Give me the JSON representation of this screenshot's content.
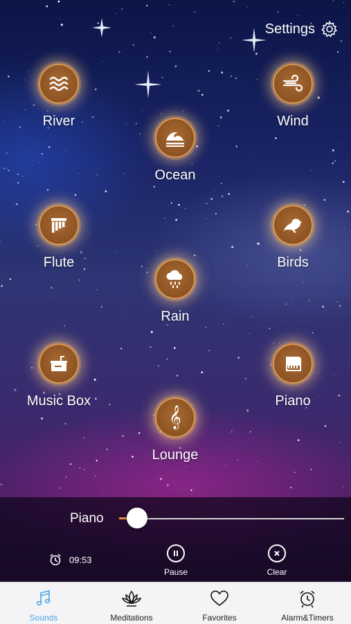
{
  "settings": {
    "label": "Settings",
    "icon": "gear-icon"
  },
  "sounds": [
    {
      "key": "river",
      "label": "River",
      "icon": "waves-icon"
    },
    {
      "key": "wind",
      "label": "Wind",
      "icon": "wind-icon"
    },
    {
      "key": "ocean",
      "label": "Ocean",
      "icon": "ocean-wave-icon"
    },
    {
      "key": "flute",
      "label": "Flute",
      "icon": "pan-flute-icon"
    },
    {
      "key": "birds",
      "label": "Birds",
      "icon": "bird-icon"
    },
    {
      "key": "rain",
      "label": "Rain",
      "icon": "rain-cloud-icon"
    },
    {
      "key": "musicbox",
      "label": "Music Box",
      "icon": "music-box-icon"
    },
    {
      "key": "piano",
      "label": "Piano",
      "icon": "grand-piano-icon"
    },
    {
      "key": "lounge",
      "label": "Lounge",
      "icon": "treble-clef-icon"
    }
  ],
  "player": {
    "track": "Piano",
    "volume": 0.08,
    "timer": "09:53",
    "pause_label": "Pause",
    "clear_label": "Clear"
  },
  "tabs": [
    {
      "label": "Sounds",
      "icon": "music-note-icon",
      "active": true
    },
    {
      "label": "Meditations",
      "icon": "lotus-icon",
      "active": false
    },
    {
      "label": "Favorites",
      "icon": "heart-icon",
      "active": false
    },
    {
      "label": "Alarm&Timers",
      "icon": "alarm-clock-icon",
      "active": false
    }
  ],
  "colors": {
    "accent": "#4aa3e6",
    "orb": "#9a5f2b",
    "slider_fill": "#e98a3a"
  }
}
